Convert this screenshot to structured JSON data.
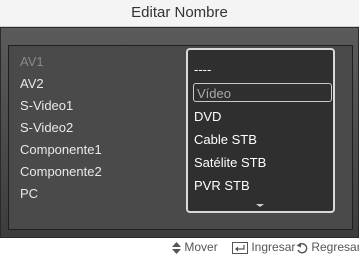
{
  "title": "Editar Nombre",
  "sources": [
    {
      "label": "AV1"
    },
    {
      "label": "AV2"
    },
    {
      "label": "S-Video1"
    },
    {
      "label": "S-Video2"
    },
    {
      "label": "Componente1"
    },
    {
      "label": "Componente2"
    },
    {
      "label": "PC"
    }
  ],
  "colon": ":",
  "dropdown": {
    "options": [
      "----",
      "Vídeo",
      "DVD",
      "Cable STB",
      "Satélite STB",
      "PVR STB"
    ],
    "selected": "Vídeo"
  },
  "footer": {
    "move": "Mover",
    "enter": "Ingresar",
    "return": "Regresar"
  },
  "icons": {
    "move": "up-down-arrows-icon",
    "enter": "enter-icon",
    "return": "return-icon"
  }
}
